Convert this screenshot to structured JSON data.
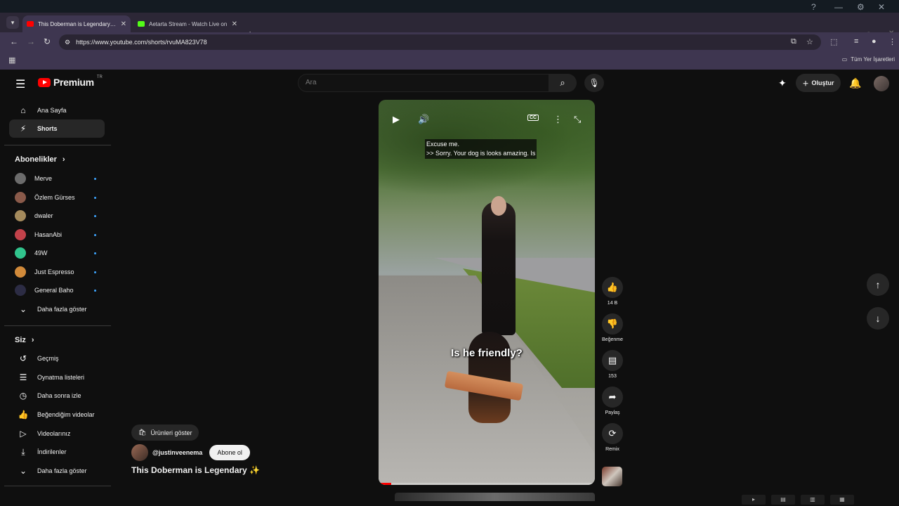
{
  "browser": {
    "tabs": [
      {
        "title": "This Doberman is Legendary ✨",
        "favicon_color": "#ff0000",
        "active": true
      },
      {
        "title": "Aetarta Stream - Watch Live on",
        "favicon_color": "#53fc18",
        "active": false
      }
    ],
    "new_tab_label": "+",
    "url": "https://www.youtube.com/shorts/rvuMA823V78",
    "all_bookmarks_label": "Tüm Yer İşaretleri"
  },
  "header": {
    "logo_text": "Premium",
    "country_code": "TR",
    "search_placeholder": "Ara",
    "create_label": "Oluştur"
  },
  "sidebar": {
    "main": [
      {
        "label": "Ana Sayfa",
        "icon": "home-icon"
      },
      {
        "label": "Shorts",
        "icon": "shorts-icon"
      }
    ],
    "subscriptions_heading": "Abonelikler",
    "subscriptions": [
      {
        "label": "Merve",
        "color": "#6c6c6c"
      },
      {
        "label": "Özlem Gürses",
        "color": "#8a5a4a"
      },
      {
        "label": "dwaler",
        "color": "#a48a5c"
      },
      {
        "label": "HasanAbi",
        "color": "#c2424a"
      },
      {
        "label": "49W",
        "color": "#31c48d"
      },
      {
        "label": "Just Espresso",
        "color": "#d18a3a"
      },
      {
        "label": "General Baho",
        "color": "#2c2c44"
      }
    ],
    "show_more_label": "Daha fazla göster",
    "you_heading": "Siz",
    "you_items": [
      {
        "label": "Geçmiş",
        "icon": "history-icon"
      },
      {
        "label": "Oynatma listeleri",
        "icon": "playlists-icon"
      },
      {
        "label": "Daha sonra izle",
        "icon": "watch-later-icon"
      },
      {
        "label": "Beğendiğim videolar",
        "icon": "liked-videos-icon"
      },
      {
        "label": "Videolarınız",
        "icon": "your-videos-icon"
      },
      {
        "label": "İndirilenler",
        "icon": "downloads-icon"
      }
    ],
    "you_show_more_label": "Daha fazla göster"
  },
  "player": {
    "caption_line1": "Excuse me.",
    "caption_line2": ">> Sorry. Your dog is looks amazing. Is",
    "burned_text": "Is he friendly?",
    "cc_label": "CC",
    "progress": 0.06
  },
  "actions": {
    "like_count": "14 B",
    "dislike_label": "Beğenme",
    "comment_count": "153",
    "share_label": "Paylaş",
    "remix_label": "Remix"
  },
  "video_info": {
    "shop_label": "Ürünleri göster",
    "channel": "@justinveenema",
    "subscribe_label": "Abone ol",
    "title": "This Doberman is Legendary ✨"
  }
}
